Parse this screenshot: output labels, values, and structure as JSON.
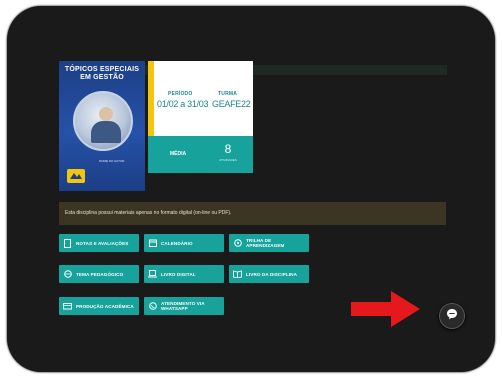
{
  "cover": {
    "title_line1": "TÓPICOS ESPECIAIS",
    "title_line2": "EM GESTÃO",
    "caption": "NOME DO AUTOR"
  },
  "info": {
    "periodo_label": "PERÍODO",
    "periodo_value": "01/02 a 31/03",
    "turma_label": "TURMA",
    "turma_value": "GEAFE22",
    "media_label": "MÉDIA",
    "count_value": "8",
    "count_label": "ATIVIDADES"
  },
  "notice": {
    "text": "Esta disciplina possui materiais apenas no formato digital (on-line ou PDF)."
  },
  "buttons": [
    {
      "label": "NOTAS E AVALIAÇÕES",
      "icon": "document-icon"
    },
    {
      "label": "CALENDÁRIO",
      "icon": "calendar-icon"
    },
    {
      "label": "TRILHA DE APRENDIZAGEM",
      "icon": "path-icon"
    },
    {
      "label": "TEMA PEDAGÓGICO",
      "icon": "globe-icon"
    },
    {
      "label": "LIVRO DIGITAL",
      "icon": "laptop-icon"
    },
    {
      "label": "LIVRO DA DISCIPLINA",
      "icon": "book-icon"
    },
    {
      "label": "PRODUÇÃO ACADÊMICA",
      "icon": "cap-icon"
    },
    {
      "label": "ATENDIMENTO VIA WHATSAPP",
      "icon": "whatsapp-icon"
    }
  ],
  "colors": {
    "teal": "#17a39b",
    "yellow": "#f2c510",
    "arrow": "#e5191b"
  }
}
